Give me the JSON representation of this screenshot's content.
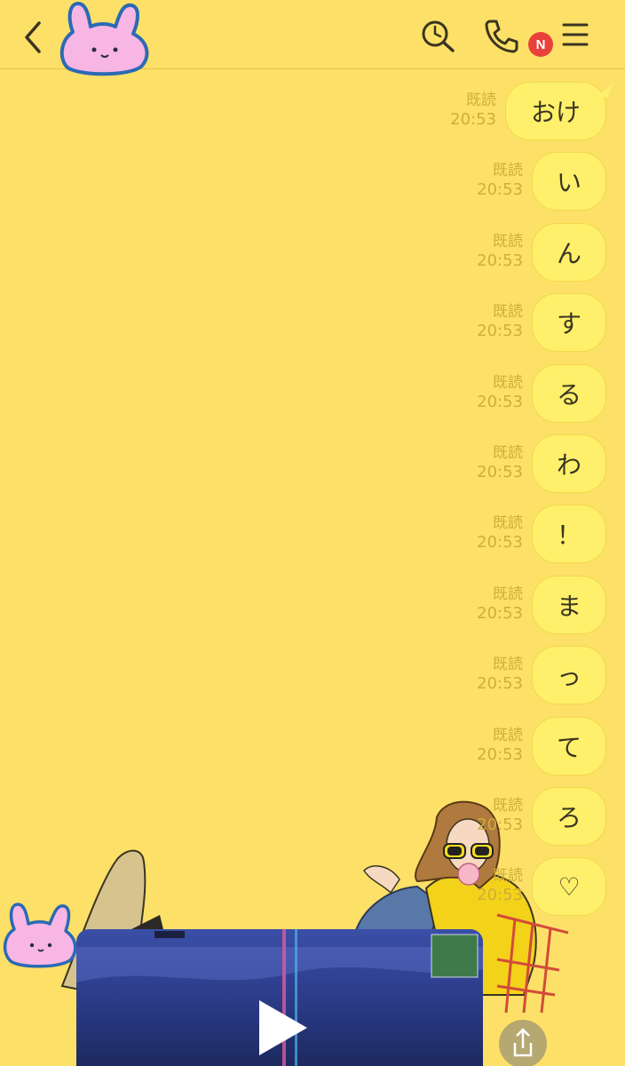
{
  "header": {
    "notification_badge": "N"
  },
  "messages": [
    {
      "text": "おけ",
      "read": "既読",
      "time": "20:53"
    },
    {
      "text": "い",
      "read": "既読",
      "time": "20:53"
    },
    {
      "text": "ん",
      "read": "既読",
      "time": "20:53"
    },
    {
      "text": "す",
      "read": "既読",
      "time": "20:53"
    },
    {
      "text": "る",
      "read": "既読",
      "time": "20:53"
    },
    {
      "text": "わ",
      "read": "既読",
      "time": "20:53"
    },
    {
      "text": "！",
      "read": "既読",
      "time": "20:53"
    },
    {
      "text": "ま",
      "read": "既読",
      "time": "20:53"
    },
    {
      "text": "っ",
      "read": "既読",
      "time": "20:53"
    },
    {
      "text": "て",
      "read": "既読",
      "time": "20:53"
    },
    {
      "text": "ろ",
      "read": "既読",
      "time": "20:53"
    },
    {
      "text": "♡",
      "read": "既読",
      "time": "20:53"
    }
  ],
  "colors": {
    "background": "#fde067",
    "bubble": "#fff06b",
    "meta_text": "#cfae3a",
    "badge": "#e8413b"
  },
  "icons": [
    "back-icon",
    "bunny-sticker",
    "search-icon",
    "phone-icon",
    "menu-icon",
    "play-icon",
    "share-icon"
  ]
}
